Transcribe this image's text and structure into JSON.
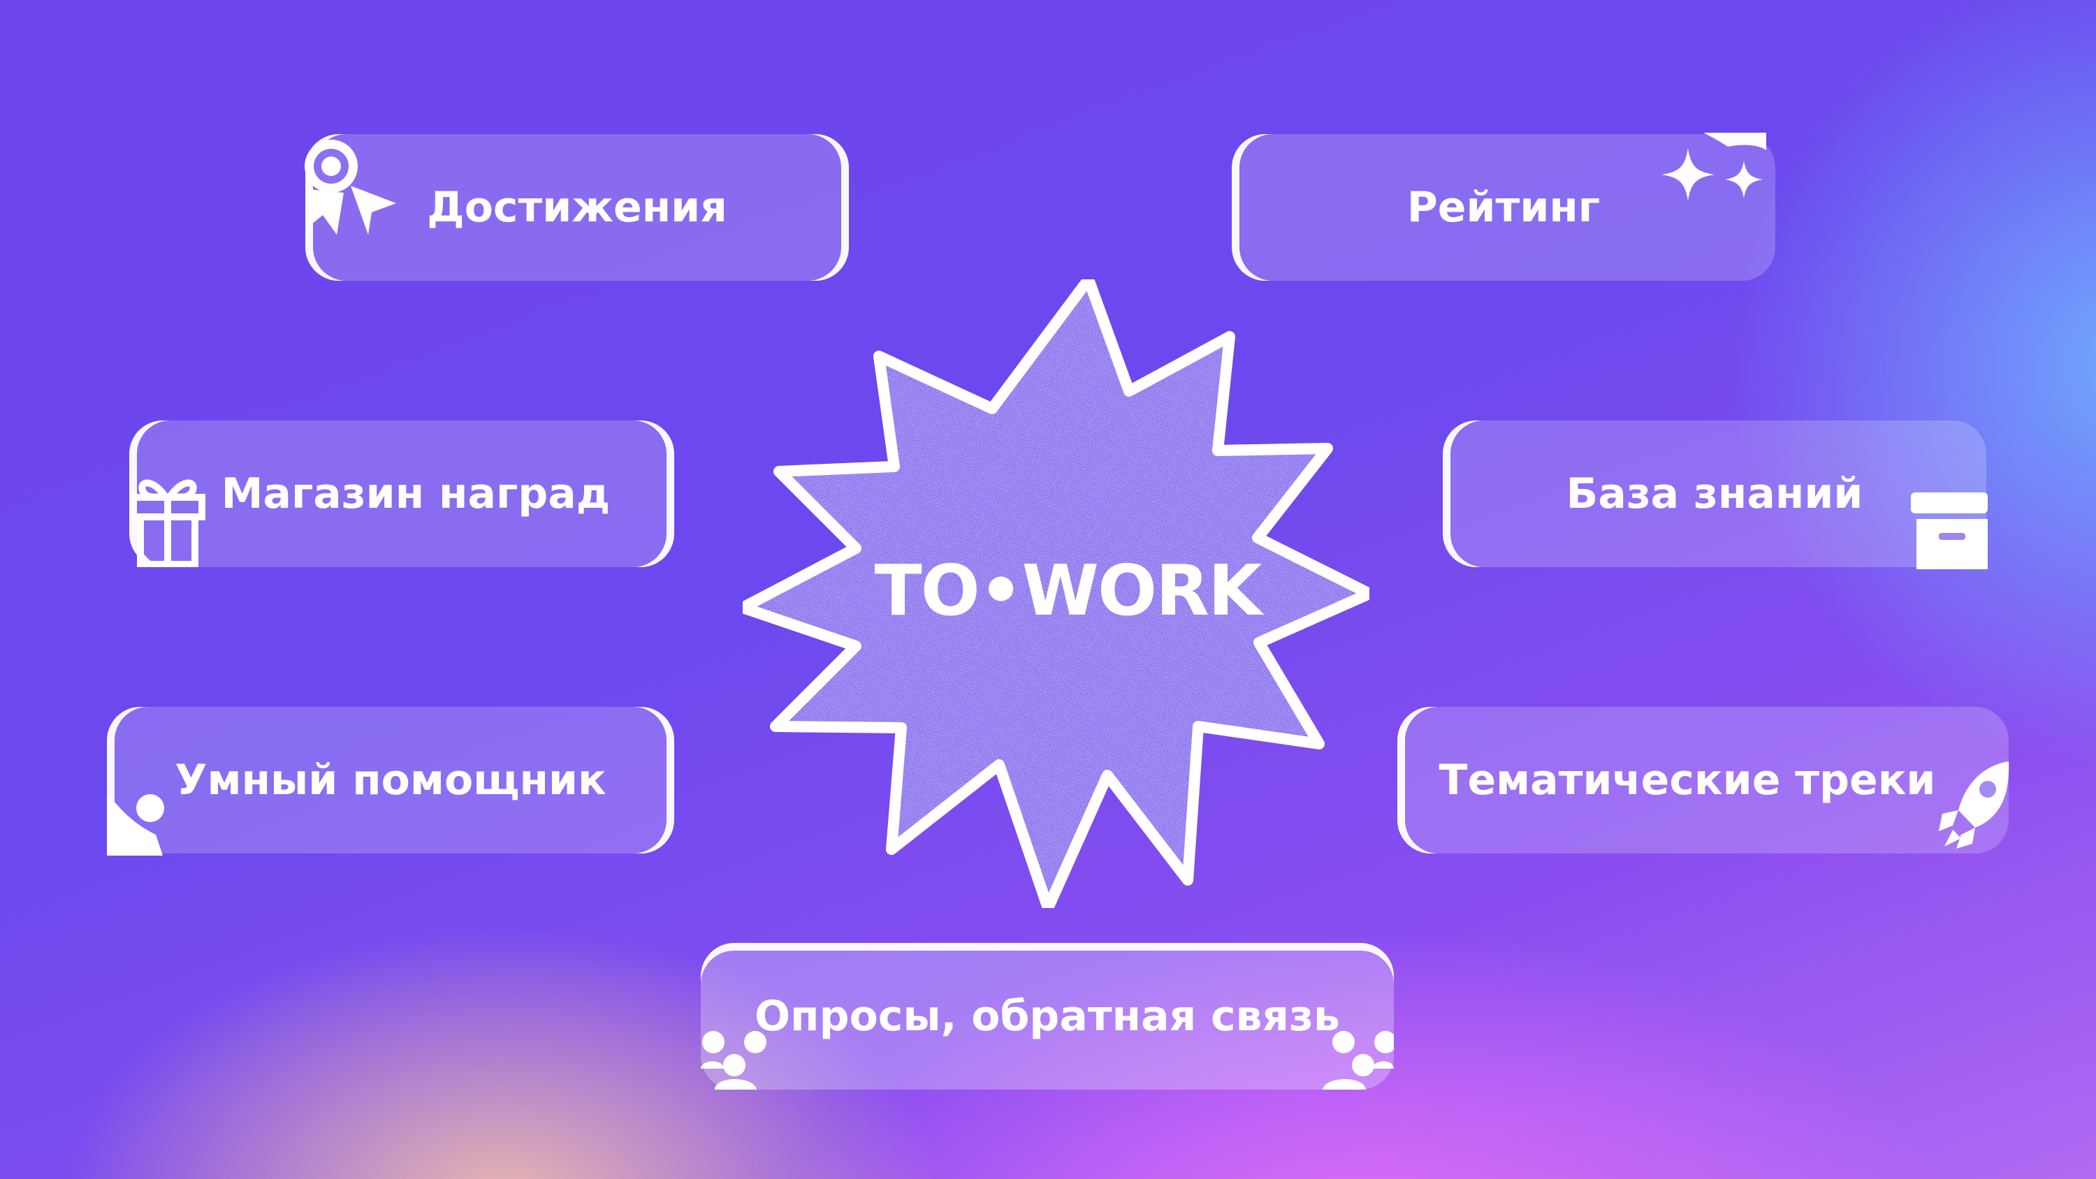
{
  "center": {
    "logo_text": "TO•WORK"
  },
  "features": {
    "achievements": "Достижения",
    "rating": "Рейтинг",
    "rewards_shop": "Магазин наград",
    "knowledge_base": "База знаний",
    "smart_assistant": "Умный помощник",
    "thematic_tracks": "Тематические треки",
    "surveys_feedback": "Опросы, обратная связь"
  },
  "icons": {
    "achievements": "award-ribbon-icon",
    "rating": "sparkles-icon",
    "rewards_shop": "gift-icon",
    "knowledge_base": "archive-box-icon",
    "smart_assistant": "assistant-shape-icon",
    "thematic_tracks": "rocket-icon",
    "surveys_feedback": "people-group-icon"
  },
  "colors": {
    "background_main": "#6e45ec",
    "accent_blue": "#6eafff",
    "accent_pink": "#e46efa",
    "text": "#ffffff"
  }
}
